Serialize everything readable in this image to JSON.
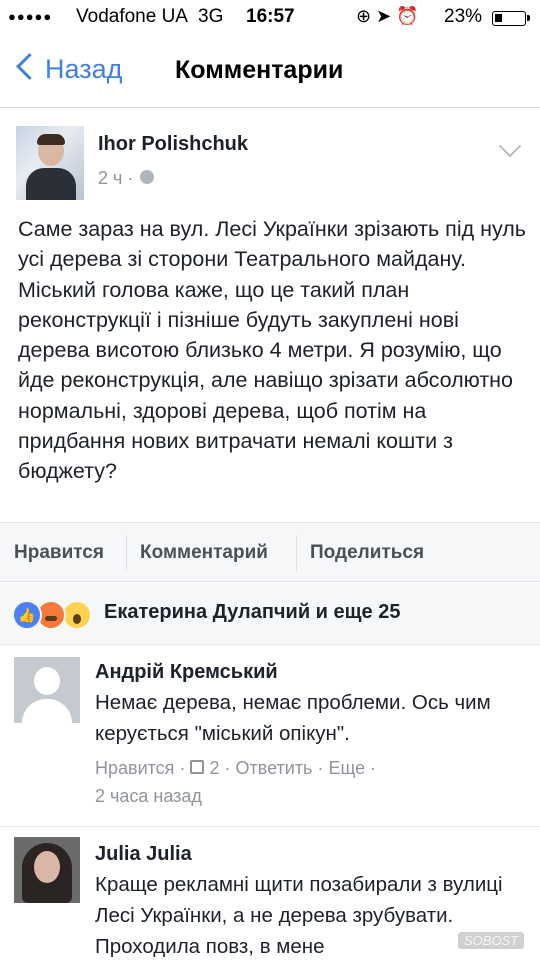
{
  "status_bar": {
    "signal": "●●●●●",
    "carrier": "Vodafone UA",
    "network": "3G",
    "time": "16:57",
    "icons": "⊕ ➤ ⏰",
    "battery": "23%"
  },
  "nav": {
    "back_label": "Назад",
    "title": "Комментарии"
  },
  "post": {
    "author": "Ihor Polishchuk",
    "time": "2 ч",
    "separator": " · ",
    "text": "Саме зараз на вул. Лесі Українки зрізають під нуль усі дерева зі сторони Театрального майдану. Міський голова каже, що це такий план реконструкції і пізніше будуть закуплені нові дерева висотою близько 4 метри. Я розумію, що йде реконструкція, але навіщо зрізати абсолютно нормальні, здорові дерева, щоб потім на придбання нових витрачати немалі кошти з бюджету?"
  },
  "actions": {
    "like": "Нравится",
    "comment": "Комментарий",
    "share": "Поделиться"
  },
  "reactions": {
    "summary": "Екатерина Дулапчий и еще 25"
  },
  "comments": [
    {
      "name": "Андрій Кремський",
      "text": "Немає дерева, немає проблеми. Ось чим керується \"міський опікун\".",
      "like_label": "Нравится",
      "like_count": "2",
      "reply_label": "Ответить",
      "more_label": "Еще",
      "time": "2 часа назад"
    },
    {
      "name": "Julia Julia",
      "text": "Краще рекламні щити позабирали з вулиці Лесі Українки, а не дерева зрубувати. Проходила повз, в мене"
    }
  ],
  "watermark": "SOBOST"
}
